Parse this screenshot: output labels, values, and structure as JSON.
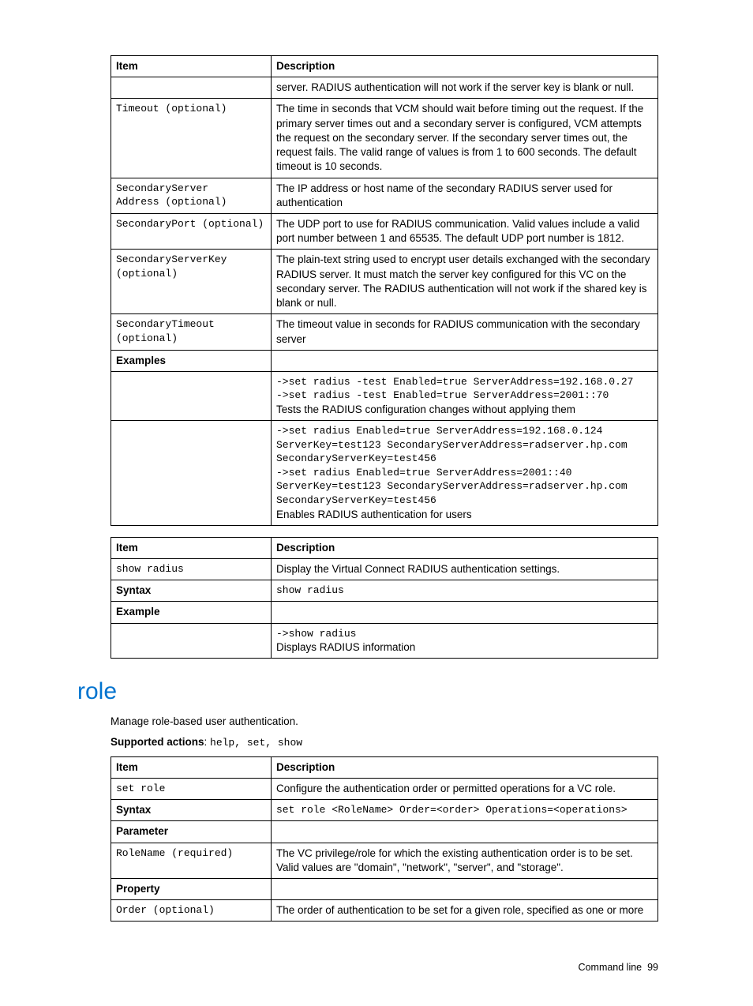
{
  "table1": {
    "head": {
      "item": "Item",
      "desc": "Description"
    },
    "rows": [
      {
        "item": "",
        "desc": "server. RADIUS authentication will not work if the server key is blank or null."
      },
      {
        "item": "Timeout (optional)",
        "desc": "The time in seconds that VCM should wait before timing out the request. If the primary server times out and a secondary server is configured, VCM attempts the request on the secondary server. If the secondary server times out, the request fails. The valid range of values is from 1 to 600 seconds. The default timeout is 10 seconds."
      },
      {
        "item": "SecondaryServer\nAddress (optional)",
        "desc": "The IP address or host name of the secondary RADIUS server used for authentication"
      },
      {
        "item": "SecondaryPort (optional)",
        "desc": "The UDP port to use for RADIUS communication. Valid values include a valid port number between 1 and 65535. The default UDP port number is 1812."
      },
      {
        "item": "SecondaryServerKey (optional)",
        "desc": "The plain-text string used to encrypt user details exchanged with the secondary RADIUS server. It must match the server key configured for this VC on the secondary server. The RADIUS authentication will not work if the shared key is blank or null."
      },
      {
        "item": "SecondaryTimeout (optional)",
        "desc": "The timeout value in seconds for RADIUS communication with the secondary server"
      }
    ],
    "examples_label": "Examples",
    "ex1_code": "->set radius -test Enabled=true ServerAddress=192.168.0.27\n->set radius -test Enabled=true ServerAddress=2001::70",
    "ex1_text": "Tests the RADIUS configuration changes without applying them",
    "ex2_code": "->set radius Enabled=true ServerAddress=192.168.0.124 ServerKey=test123 SecondaryServerAddress=radserver.hp.com SecondaryServerKey=test456\n->set radius Enabled=true ServerAddress=2001::40 ServerKey=test123 SecondaryServerAddress=radserver.hp.com SecondaryServerKey=test456",
    "ex2_text": "Enables RADIUS authentication for users"
  },
  "table2": {
    "head": {
      "item": "Item",
      "desc": "Description"
    },
    "r1_item": "show radius",
    "r1_desc": "Display the Virtual Connect RADIUS authentication settings.",
    "syntax_label": "Syntax",
    "syntax_val": "show radius",
    "example_label": "Example",
    "ex_code": "->show radius",
    "ex_text": "Displays RADIUS information"
  },
  "role": {
    "heading": "role",
    "intro": "Manage role-based user authentication.",
    "supported_label": "Supported actions",
    "supported_vals": "help, set, show"
  },
  "table3": {
    "head": {
      "item": "Item",
      "desc": "Description"
    },
    "r1_item": "set role",
    "r1_desc": "Configure the authentication order or permitted operations for a VC role.",
    "syntax_label": "Syntax",
    "syntax_val": "set role <RoleName> Order=<order> Operations=<operations>",
    "param_label": "Parameter",
    "p1_item": "RoleName (required)",
    "p1_desc": "The VC privilege/role for which the existing authentication order is to be set. Valid values are \"domain\", \"network\", \"server\", and \"storage\".",
    "prop_label": "Property",
    "pr1_item": "Order (optional)",
    "pr1_desc": "The order of authentication to be set for a given role, specified as one or more"
  },
  "footer": {
    "section": "Command line",
    "page": "99"
  }
}
